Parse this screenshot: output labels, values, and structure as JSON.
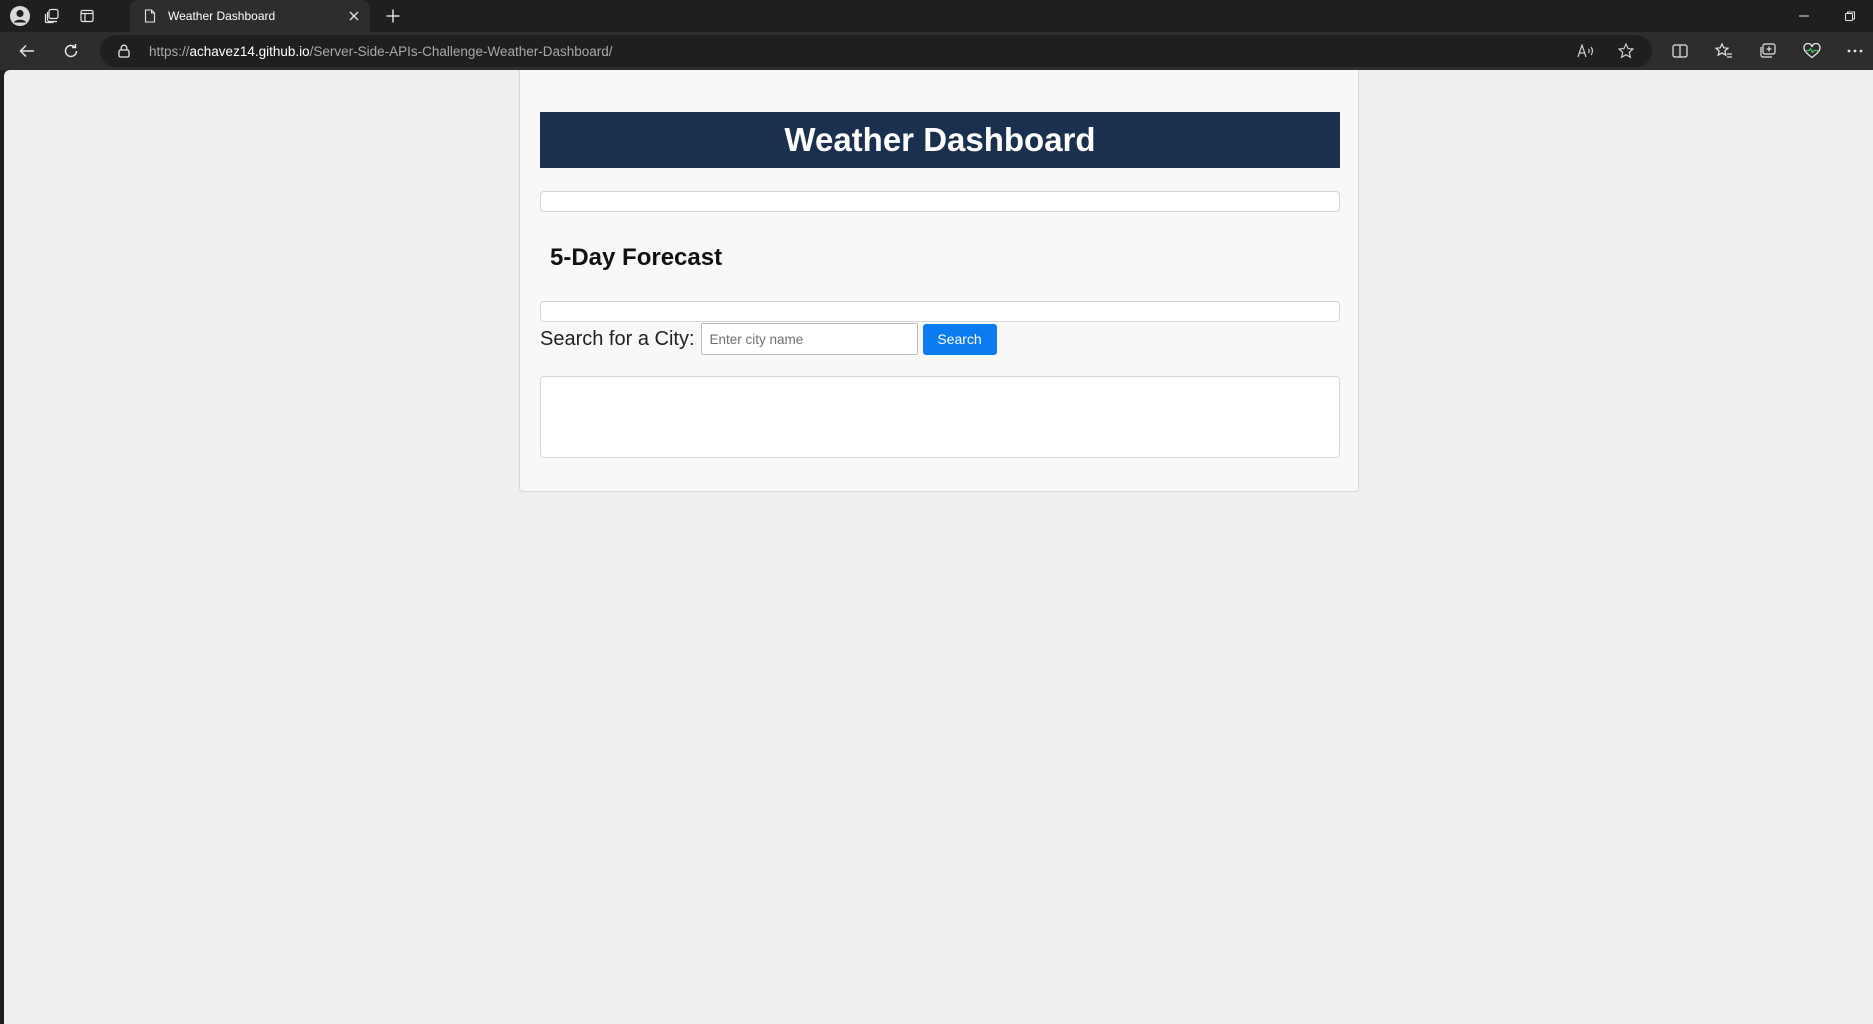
{
  "browser": {
    "tab": {
      "title": "Weather Dashboard"
    },
    "address_bar": {
      "url_scheme": "https://",
      "url_host": "achavez14.github.io",
      "url_path": "/Server-Side-APIs-Challenge-Weather-Dashboard/"
    },
    "icons": {
      "profile": "profile-avatar-icon",
      "workspaces": "workspaces-icon",
      "tab_actions": "tab-actions-icon",
      "new_tab": "plus-icon",
      "minimize": "minimize-icon",
      "restore": "restore-icon",
      "back": "arrow-left-icon",
      "refresh": "refresh-icon",
      "lock": "lock-icon",
      "read_aloud": "read-aloud-icon",
      "favorite": "star-icon",
      "split_screen": "split-screen-icon",
      "favorites": "favorites-list-icon",
      "collections": "collections-icon",
      "browser_essentials": "heart-pulse-icon",
      "more": "more-dots-icon"
    }
  },
  "page": {
    "header_title": "Weather Dashboard",
    "forecast_title": "5-Day Forecast",
    "search": {
      "label": "Search for a City:",
      "placeholder": "Enter city name",
      "value": "",
      "button_label": "Search"
    },
    "colors": {
      "header_bg": "#1b2f4e",
      "button_bg": "#0b7cf0",
      "page_bg": "#efefef"
    }
  }
}
